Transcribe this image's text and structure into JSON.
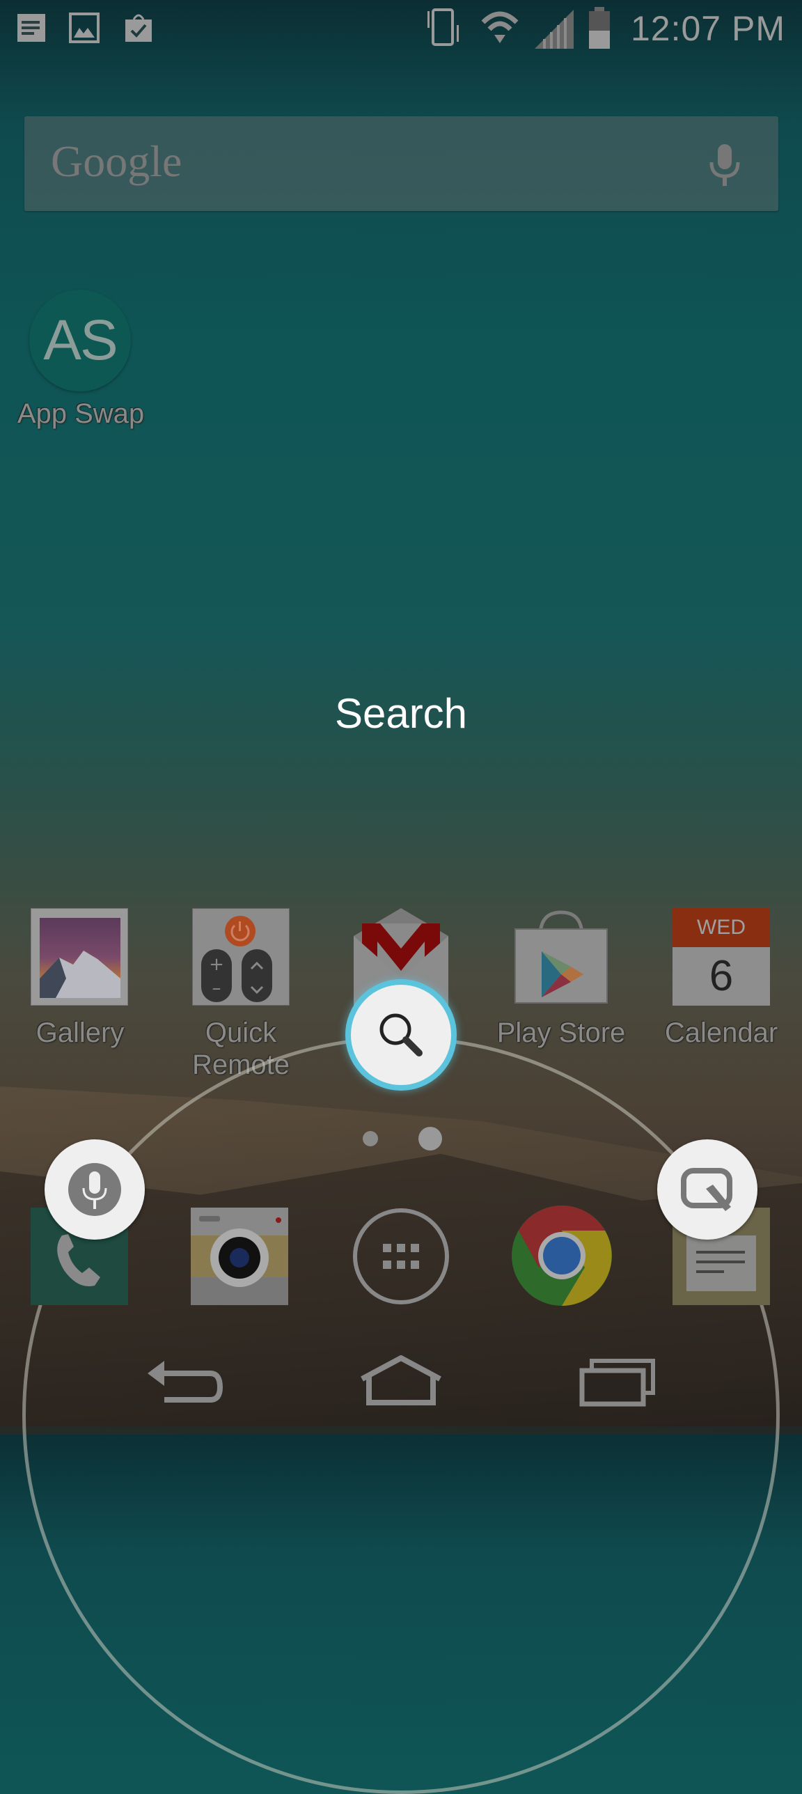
{
  "status_bar": {
    "notification_icons": [
      "notes-icon",
      "gallery-icon",
      "shopping-bag-check-icon"
    ],
    "system_icons": [
      "vibrate-icon",
      "wifi-icon",
      "signal-icon",
      "battery-icon"
    ],
    "time": "12:07 PM"
  },
  "google_bar": {
    "logo_text": "Google",
    "mic_icon": "microphone-icon"
  },
  "desktop_shortcut": {
    "icon_text": "AS",
    "label": "App Swap"
  },
  "overlay": {
    "action_label": "Search",
    "center_button_icon": "search-icon",
    "left_button_icon": "microphone-icon",
    "right_button_icon": "qmemo-icon",
    "accent_color": "#5bc4dc"
  },
  "apps_row": [
    {
      "label": "Gallery",
      "icon": "gallery-icon"
    },
    {
      "label": "Quick Remote",
      "icon": "remote-icon"
    },
    {
      "label": "Gmail",
      "icon": "gmail-icon"
    },
    {
      "label": "Play Store",
      "icon": "play-store-icon"
    },
    {
      "label": "Calendar",
      "icon": "calendar-icon",
      "day": "WED",
      "date": "6"
    }
  ],
  "page_indicator": {
    "pages": 2,
    "current": 2
  },
  "dock": [
    {
      "name": "Phone",
      "icon": "phone-icon"
    },
    {
      "name": "Camera",
      "icon": "camera-icon"
    },
    {
      "name": "Apps",
      "icon": "app-drawer-icon"
    },
    {
      "name": "Chrome",
      "icon": "chrome-icon"
    },
    {
      "name": "Messaging",
      "icon": "messaging-icon"
    }
  ],
  "nav_bar": [
    "back-icon",
    "home-icon",
    "recent-apps-icon"
  ]
}
